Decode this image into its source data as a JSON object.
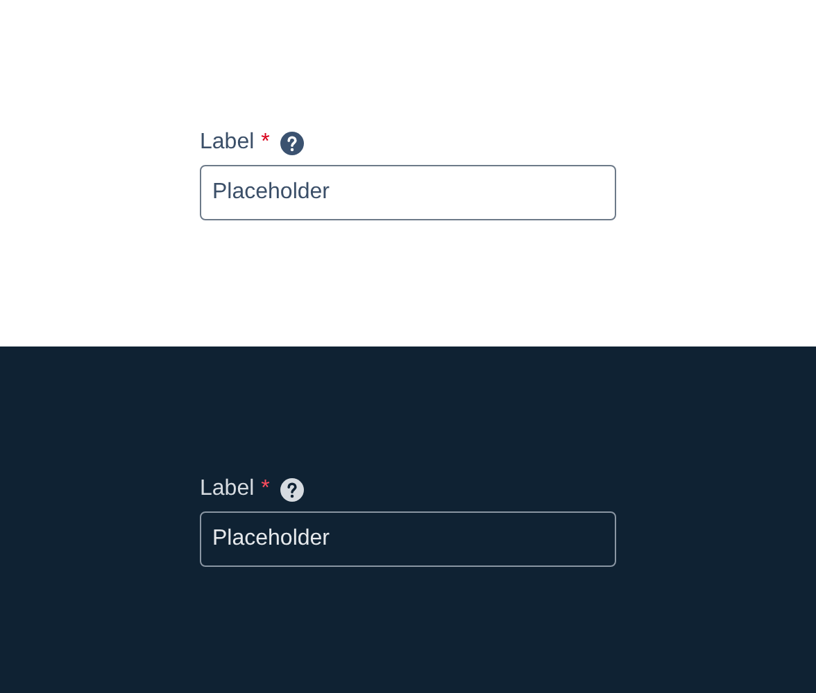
{
  "panels": [
    {
      "kind": "light",
      "label": "Label",
      "required_mark": "*",
      "placeholder": "Placeholder"
    },
    {
      "kind": "dark",
      "label": "Label",
      "required_mark": "*",
      "placeholder": "Placeholder"
    }
  ]
}
